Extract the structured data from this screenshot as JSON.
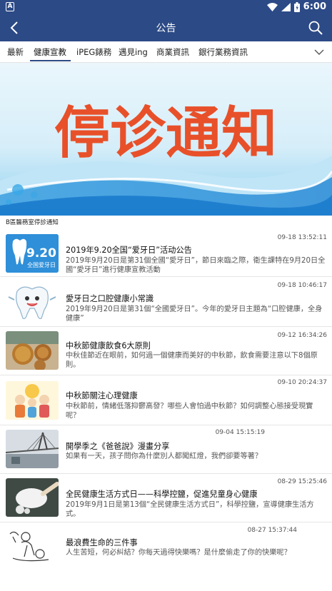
{
  "status_bar": {
    "time": "6:00",
    "left_icon": "A"
  },
  "app_bar": {
    "title": "公告"
  },
  "tabs": [
    {
      "label": "最新",
      "active": false
    },
    {
      "label": "健康宣教",
      "active": true
    },
    {
      "label": "iPEG錶務",
      "active": false
    },
    {
      "label": "遇見ing",
      "active": false
    },
    {
      "label": "商業資訊",
      "active": false
    },
    {
      "label": "銀行業務資訊",
      "active": false
    }
  ],
  "banner": {
    "headline": "停诊通知",
    "caption": "B區醫務室停診通知"
  },
  "news": [
    {
      "timestamp": "09-18 13:52:11",
      "title": "2019年9.20全国“爱牙日”活动公告",
      "desc": "2019年9月20日是第31個全國“愛牙日”，節日來臨之際，衛生課特在9月20日全國“愛牙日”進行健康宣教活動",
      "thumb_icon": "tooth-poster-icon",
      "thumb_text": "9.20",
      "thumb_subtext": "全国爱牙日"
    },
    {
      "timestamp": "09-18 10:46:17",
      "title": "愛牙日之口腔健康小常識",
      "desc": "2019年9月20日是第31個“全國愛牙日”。今年的愛牙日主題為“口腔健康，全身健康”",
      "thumb_icon": "cartoon-tooth-icon"
    },
    {
      "timestamp": "09-12 16:34:26",
      "title": "中秋節健康飲食6大原則",
      "desc": "中秋佳節近在眼前，如何過一個健康而美好的中秋節，飲食需要注意以下8個原則。",
      "thumb_icon": "mooncake-icon"
    },
    {
      "timestamp": "09-10 20:24:37",
      "title": "中秋節關注心理健康",
      "desc": "中秋節前，情緒低落抑鬱高發？哪些人會怕過中秋節？如何調整心態接受現實呢？",
      "thumb_icon": "family-cartoon-icon"
    },
    {
      "timestamp": "09-04 15:15:19",
      "title": "開學季之《爸爸說》漫畫分享",
      "desc": "如果有一天，孩子問你為什麼別人都闖紅燈，我們卻要等著？",
      "thumb_icon": "bridge-photo-icon"
    },
    {
      "timestamp": "08-29 15:25:46",
      "title": "全民健康生活方式日——科學控鹽，促進兒童身心健康",
      "desc": "2019年9月1日是第13個“全民健康生活方式日”，科學控鹽，宣導健康生活方式。",
      "thumb_icon": "salt-spoon-icon"
    },
    {
      "timestamp": "08-27 15:37:44",
      "title": "最浪費生命的三件事",
      "desc": "人生苦短，何必糾結？你每天過得快樂嗎？是什麼偷走了你的快樂呢？",
      "thumb_icon": "sketch-drawing-icon"
    }
  ]
}
